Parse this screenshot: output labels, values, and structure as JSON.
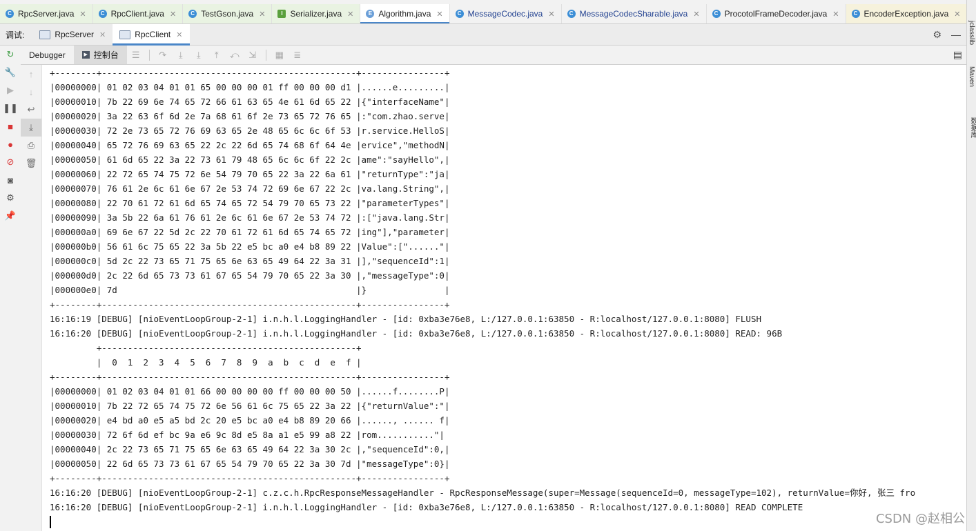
{
  "editor_tabs": [
    {
      "label": "RpcServer.java",
      "icon": "C",
      "style": "green"
    },
    {
      "label": "RpcClient.java",
      "icon": "C",
      "style": "green"
    },
    {
      "label": "TestGson.java",
      "icon": "C",
      "style": "green"
    },
    {
      "label": "Serializer.java",
      "icon": "I",
      "style": "green"
    },
    {
      "label": "Algorithm.java",
      "icon": "E",
      "style": "active"
    },
    {
      "label": "MessageCodec.java",
      "icon": "C",
      "style": "blue"
    },
    {
      "label": "MessageCodecSharable.java",
      "icon": "C",
      "style": "blue"
    },
    {
      "label": "ProcotolFrameDecoder.java",
      "icon": "C",
      "style": "plain"
    },
    {
      "label": "EncoderException.java",
      "icon": "C",
      "style": "yellow"
    }
  ],
  "debug": {
    "label": "调试:",
    "tabs": [
      {
        "label": "RpcServer"
      },
      {
        "label": "RpcClient"
      }
    ]
  },
  "toolbar": {
    "debugger_tab": "Debugger",
    "console_tab": "控制台"
  },
  "console_lines": [
    "+--------+-------------------------------------------------+----------------+",
    "|00000000| 01 02 03 04 01 01 65 00 00 00 01 ff 00 00 00 d1 |......e.........|",
    "|00000010| 7b 22 69 6e 74 65 72 66 61 63 65 4e 61 6d 65 22 |{\"interfaceName\"|",
    "|00000020| 3a 22 63 6f 6d 2e 7a 68 61 6f 2e 73 65 72 76 65 |:\"com.zhao.serve|",
    "|00000030| 72 2e 73 65 72 76 69 63 65 2e 48 65 6c 6c 6f 53 |r.service.HelloS|",
    "|00000040| 65 72 76 69 63 65 22 2c 22 6d 65 74 68 6f 64 4e |ervice\",\"methodN|",
    "|00000050| 61 6d 65 22 3a 22 73 61 79 48 65 6c 6c 6f 22 2c |ame\":\"sayHello\",|",
    "|00000060| 22 72 65 74 75 72 6e 54 79 70 65 22 3a 22 6a 61 |\"returnType\":\"ja|",
    "|00000070| 76 61 2e 6c 61 6e 67 2e 53 74 72 69 6e 67 22 2c |va.lang.String\",|",
    "|00000080| 22 70 61 72 61 6d 65 74 65 72 54 79 70 65 73 22 |\"parameterTypes\"|",
    "|00000090| 3a 5b 22 6a 61 76 61 2e 6c 61 6e 67 2e 53 74 72 |:[\"java.lang.Str|",
    "|000000a0| 69 6e 67 22 5d 2c 22 70 61 72 61 6d 65 74 65 72 |ing\"],\"parameter|",
    "|000000b0| 56 61 6c 75 65 22 3a 5b 22 e5 bc a0 e4 b8 89 22 |Value\":[\"......\"|",
    "|000000c0| 5d 2c 22 73 65 71 75 65 6e 63 65 49 64 22 3a 31 |],\"sequenceId\":1|",
    "|000000d0| 2c 22 6d 65 73 73 61 67 65 54 79 70 65 22 3a 30 |,\"messageType\":0|",
    "|000000e0| 7d                                              |}               |",
    "+--------+-------------------------------------------------+----------------+",
    "16:16:19 [DEBUG] [nioEventLoopGroup-2-1] i.n.h.l.LoggingHandler - [id: 0xba3e76e8, L:/127.0.0.1:63850 - R:localhost/127.0.0.1:8080] FLUSH",
    "16:16:20 [DEBUG] [nioEventLoopGroup-2-1] i.n.h.l.LoggingHandler - [id: 0xba3e76e8, L:/127.0.0.1:63850 - R:localhost/127.0.0.1:8080] READ: 96B",
    "         +-------------------------------------------------+",
    "         |  0  1  2  3  4  5  6  7  8  9  a  b  c  d  e  f |",
    "+--------+-------------------------------------------------+----------------+",
    "|00000000| 01 02 03 04 01 01 66 00 00 00 00 ff 00 00 00 50 |......f........P|",
    "|00000010| 7b 22 72 65 74 75 72 6e 56 61 6c 75 65 22 3a 22 |{\"returnValue\":\"|",
    "|00000020| e4 bd a0 e5 a5 bd 2c 20 e5 bc a0 e4 b8 89 20 66 |......, ...... f|",
    "|00000030| 72 6f 6d ef bc 9a e6 9c 8d e5 8a a1 e5 99 a8 22 |rom...........\"|",
    "|00000040| 2c 22 73 65 71 75 65 6e 63 65 49 64 22 3a 30 2c |,\"sequenceId\":0,|",
    "|00000050| 22 6d 65 73 73 61 67 65 54 79 70 65 22 3a 30 7d |\"messageType\":0}|",
    "+--------+-------------------------------------------------+----------------+",
    "16:16:20 [DEBUG] [nioEventLoopGroup-2-1] c.z.c.h.RpcResponseMessageHandler - RpcResponseMessage(super=Message(sequenceId=0, messageType=102), returnValue=你好, 张三 fro",
    "16:16:20 [DEBUG] [nioEventLoopGroup-2-1] i.n.h.l.LoggingHandler - [id: 0xba3e76e8, L:/127.0.0.1:63850 - R:localhost/127.0.0.1:8080] READ COMPLETE"
  ],
  "right_sidebar": {
    "items": [
      "jclasslib",
      "Maven",
      "数据库"
    ]
  },
  "watermark": "CSDN @赵相公"
}
